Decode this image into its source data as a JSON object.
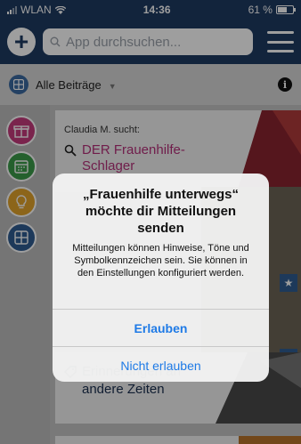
{
  "status": {
    "carrier": "WLAN",
    "time": "14:36",
    "battery": "61 %",
    "battery_level": 0.61
  },
  "header": {
    "search_placeholder": "App durchsuchen...",
    "add_icon": "plus-icon",
    "menu_icon": "hamburger-icon"
  },
  "filter": {
    "label": "Alle Beiträge"
  },
  "categories": [
    "gift-icon",
    "calendar-icon",
    "lightbulb-icon",
    "grid-icon"
  ],
  "feed": {
    "card1": {
      "meta": "Claudia M. sucht:",
      "title": "DER Frauenhilfe-Schlager"
    },
    "card2": {
      "title": "Erinnerungen an andere Zeiten"
    }
  },
  "dialog": {
    "title": "„Frauenhilfe unterwegs“ möchte dir Mitteilungen senden",
    "message": "Mitteilungen können Hinweise, Töne und Symbolkennzeichen sein. Sie können in den Einstellungen konfiguriert werden.",
    "allow": "Erlauben",
    "deny": "Nicht erlauben"
  },
  "colors": {
    "navy": "#1e3a62",
    "accent_pink": "#b5307a",
    "ios_blue": "#1e7ae6"
  }
}
